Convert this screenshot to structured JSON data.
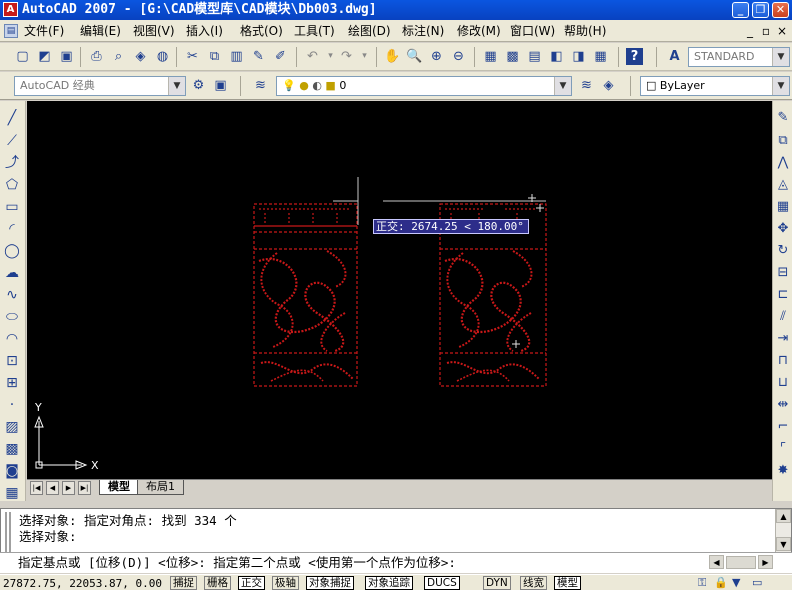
{
  "window": {
    "title": "AutoCAD 2007 - [G:\\CAD模型库\\CAD模块\\Db003.dwg]",
    "app_icon": "A",
    "controls": [
      "_",
      "❐",
      "✕"
    ]
  },
  "menu": [
    "文件(F)",
    "编辑(E)",
    "视图(V)",
    "插入(I)",
    "格式(O)",
    "工具(T)",
    "绘图(D)",
    "标注(N)",
    "修改(M)",
    "窗口(W)",
    "帮助(H)"
  ],
  "menu_doc_controls": [
    "_",
    "▫",
    "×"
  ],
  "toolbar": {
    "text_style": "STANDARD"
  },
  "toolbar2": {
    "workspace": "AutoCAD 经典",
    "layer": "0",
    "linetype": "ByLayer"
  },
  "canvas": {
    "tooltip": "正交: 2674.25 < 180.00°",
    "ucs_x": "X",
    "ucs_y": "Y",
    "colors": {
      "background": "#000000",
      "pattern": "#c81818",
      "crosshair": "#c8c8c8"
    }
  },
  "tabs": {
    "model": "模型",
    "layout1": "布局1"
  },
  "command": {
    "line1": "选择对象: 指定对角点: 找到 334 个",
    "line2": "选择对象:",
    "prompt": "指定基点或 [位移(D)] <位移>:  指定第二个点或 <使用第一个点作为位移>:"
  },
  "status": {
    "coords": "27872.75, 22053.87, 0.00",
    "buttons": [
      {
        "label": "捕捉",
        "on": false
      },
      {
        "label": "栅格",
        "on": false
      },
      {
        "label": "正交",
        "on": true
      },
      {
        "label": "极轴",
        "on": false
      },
      {
        "label": "对象捕捉",
        "on": true
      },
      {
        "label": "对象追踪",
        "on": true
      },
      {
        "label": "DUCS",
        "on": true
      },
      {
        "label": "DYN",
        "on": false
      },
      {
        "label": "线宽",
        "on": false
      },
      {
        "label": "模型",
        "on": true
      }
    ]
  }
}
